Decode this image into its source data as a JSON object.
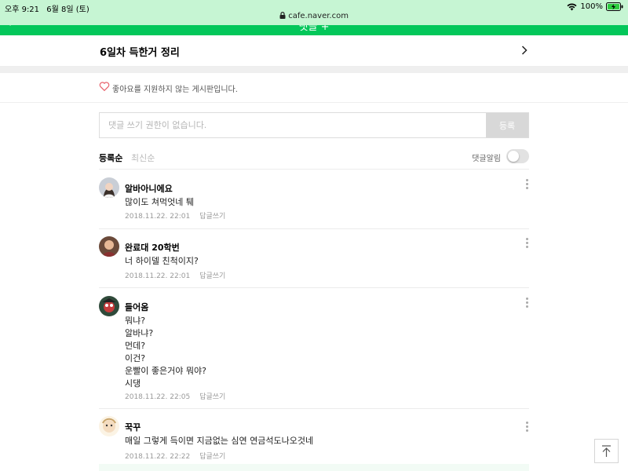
{
  "status_bar": {
    "time": "오후 9:21",
    "date": "6월 8일 (토)",
    "battery": "100%",
    "url": "cafe.naver.com"
  },
  "header": {
    "partial_title": "댓글 +",
    "accent_color": "#03c75a"
  },
  "board": {
    "title": "6일차 득한거 정리",
    "chevron_icon": "chevron-right-icon"
  },
  "like_notice": {
    "icon": "heart-outline-icon",
    "text": "좋아요를 지원하지 않는 게시판입니다."
  },
  "comment_input": {
    "placeholder": "댓글 쓰기 권한이 없습니다.",
    "submit_label": "등록"
  },
  "sort": {
    "option_registered": "등록순",
    "option_latest": "최신순",
    "alarm_label": "댓글알림",
    "alarm_on": false
  },
  "comments": [
    {
      "author": "알바아니에요",
      "lines": [
        "많이도 쳐먹엇네 퉤"
      ],
      "date": "2018.11.22. 22:01",
      "reply_label": "답글쓰기"
    },
    {
      "author": "완료대 20학번",
      "lines": [
        "너 하이델 친척이지?"
      ],
      "date": "2018.11.22. 22:01",
      "reply_label": "답글쓰기"
    },
    {
      "author": "들어옴",
      "lines": [
        "뭐냐?",
        "알바냐?",
        "먼데?",
        "이건?",
        "운빨이 좋은거야 뭐야?",
        "시댕"
      ],
      "date": "2018.11.22. 22:05",
      "reply_label": "답글쓰기"
    },
    {
      "author": "꾹꾸",
      "lines": [
        "매일 그렇게 득이면 지금없는 심연 연금석도나오것네"
      ],
      "date": "2018.11.22. 22:22",
      "reply_label": "답글쓰기"
    }
  ],
  "scroll_top_icon": "arrow-up-to-top-icon"
}
